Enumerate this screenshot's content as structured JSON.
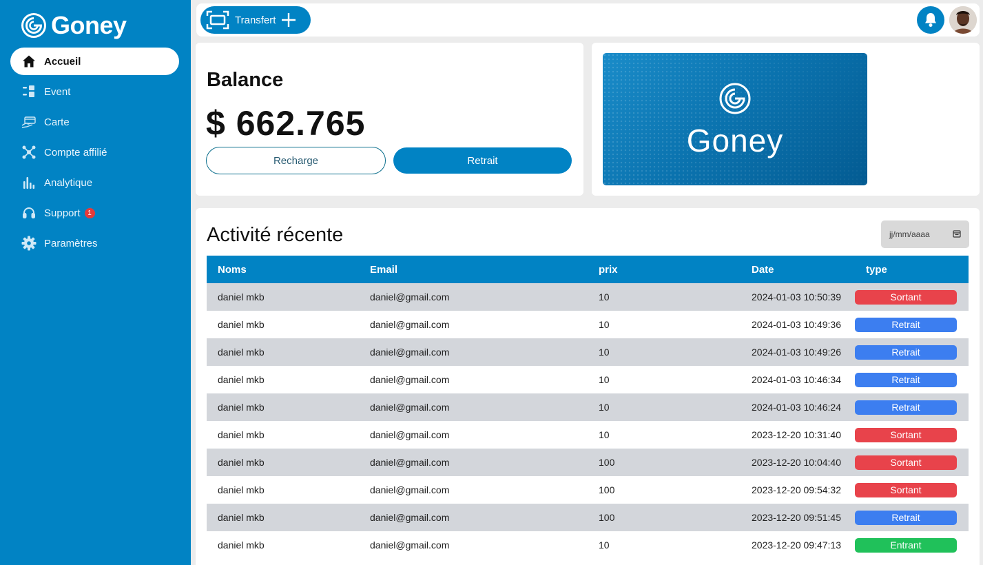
{
  "app": {
    "logo_text": "Goney"
  },
  "colors": {
    "primary": "#0183c4",
    "sortant": "#e8434b",
    "retrait": "#3c7ef0",
    "entrant": "#20c15a",
    "badge": "#e53a3a"
  },
  "sidebar": {
    "items": [
      {
        "label": "Accueil",
        "icon": "home-icon"
      },
      {
        "label": "Event",
        "icon": "grid-icon"
      },
      {
        "label": "Carte",
        "icon": "card-hand-icon"
      },
      {
        "label": "Compte affilié",
        "icon": "network-icon"
      },
      {
        "label": "Analytique",
        "icon": "bar-chart-icon"
      },
      {
        "label": "Support",
        "icon": "headset-icon",
        "badge": "1"
      },
      {
        "label": "Paramètres",
        "icon": "gear-icon"
      }
    ]
  },
  "topbar": {
    "transfer_label": "Transfert"
  },
  "balance": {
    "title": "Balance",
    "amount": "$ 662.765",
    "recharge_label": "Recharge",
    "retrait_label": "Retrait"
  },
  "card": {
    "brand": "Goney"
  },
  "activity": {
    "title": "Activité récente",
    "date_placeholder": "jj/mm/aaaa",
    "columns": [
      "Noms",
      "Email",
      "prix",
      "Date",
      "type"
    ],
    "rows": [
      {
        "name": "daniel mkb",
        "email": "daniel@gmail.com",
        "prix": "10",
        "date": "2024-01-03 10:50:39",
        "type": "Sortant"
      },
      {
        "name": "daniel mkb",
        "email": "daniel@gmail.com",
        "prix": "10",
        "date": "2024-01-03 10:49:36",
        "type": "Retrait"
      },
      {
        "name": "daniel mkb",
        "email": "daniel@gmail.com",
        "prix": "10",
        "date": "2024-01-03 10:49:26",
        "type": "Retrait"
      },
      {
        "name": "daniel mkb",
        "email": "daniel@gmail.com",
        "prix": "10",
        "date": "2024-01-03 10:46:34",
        "type": "Retrait"
      },
      {
        "name": "daniel mkb",
        "email": "daniel@gmail.com",
        "prix": "10",
        "date": "2024-01-03 10:46:24",
        "type": "Retrait"
      },
      {
        "name": "daniel mkb",
        "email": "daniel@gmail.com",
        "prix": "10",
        "date": "2023-12-20 10:31:40",
        "type": "Sortant"
      },
      {
        "name": "daniel mkb",
        "email": "daniel@gmail.com",
        "prix": "100",
        "date": "2023-12-20 10:04:40",
        "type": "Sortant"
      },
      {
        "name": "daniel mkb",
        "email": "daniel@gmail.com",
        "prix": "100",
        "date": "2023-12-20 09:54:32",
        "type": "Sortant"
      },
      {
        "name": "daniel mkb",
        "email": "daniel@gmail.com",
        "prix": "100",
        "date": "2023-12-20 09:51:45",
        "type": "Retrait"
      },
      {
        "name": "daniel mkb",
        "email": "daniel@gmail.com",
        "prix": "10",
        "date": "2023-12-20 09:47:13",
        "type": "Entrant"
      }
    ]
  }
}
